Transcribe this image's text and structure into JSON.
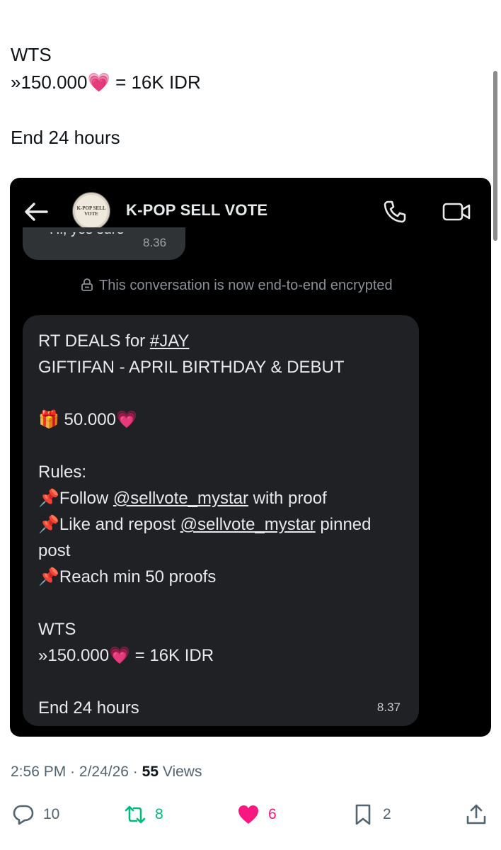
{
  "tweet": {
    "lines": [
      "WTS",
      "»150.000",
      "= 16K IDR",
      "End 24 hours"
    ],
    "heart_emoji": "💗"
  },
  "screenshot": {
    "chat_name": "K-POP SELL VOTE",
    "avatar_text": "K-POP SELL VOTE",
    "previous_message": {
      "text": "Hi, yes sure",
      "time": "8.36"
    },
    "encryption_notice": "This conversation is now end-to-end encrypted",
    "message": {
      "l1_prefix": "RT DEALS for ",
      "l1_tag": "#JAY",
      "l2": "GIFTIFAN - APRIL BIRTHDAY & DEBUT",
      "gift_emoji": "🎁",
      "gift_amount": " 50.000",
      "heart_emoji": "💗",
      "rules_label": "Rules:",
      "pin_emoji": "📌",
      "rule1_prefix": "Follow ",
      "rule1_mention": "@sellvote_mystar",
      "rule1_suffix": " with proof",
      "rule2_prefix": "Like and repost ",
      "rule2_mention": "@sellvote_mystar",
      "rule2_suffix": " pinned",
      "rule2_cont": "post",
      "rule3": "Reach min 50 proofs",
      "wts": "WTS",
      "price": "»150.000",
      "price_eq": " = 16K IDR",
      "end": "End 24 hours",
      "time": "8.37"
    }
  },
  "meta": {
    "time": "2:56 PM",
    "sep": " · ",
    "date": "2/24/26",
    "views_count": "55",
    "views_label": " Views"
  },
  "actions": {
    "replies": "10",
    "reposts": "8",
    "likes": "6",
    "bookmarks": "2"
  },
  "colors": {
    "repost_green": "#00ba7c",
    "like_pink": "#f91880",
    "icon_gray": "#536471"
  }
}
